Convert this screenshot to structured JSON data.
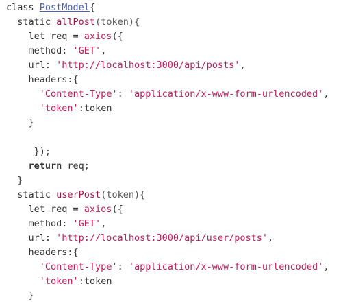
{
  "lines": [
    [
      {
        "t": "class ",
        "c": "kw"
      },
      {
        "t": "PostModel",
        "c": "cls"
      },
      {
        "t": "{",
        "c": "plain"
      }
    ],
    [
      {
        "t": "  static ",
        "c": "kw"
      },
      {
        "t": "allPost",
        "c": "fn-title"
      },
      {
        "t": "(token){",
        "c": "param"
      }
    ],
    [
      {
        "t": "    let req = ",
        "c": "plain"
      },
      {
        "t": "axios",
        "c": "fn"
      },
      {
        "t": "({",
        "c": "plain"
      }
    ],
    [
      {
        "t": "    method: ",
        "c": "plain"
      },
      {
        "t": "'GET'",
        "c": "str"
      },
      {
        "t": ",",
        "c": "plain"
      }
    ],
    [
      {
        "t": "    url: ",
        "c": "plain"
      },
      {
        "t": "'http://localhost:3000/api/posts'",
        "c": "str"
      },
      {
        "t": ",",
        "c": "plain"
      }
    ],
    [
      {
        "t": "    headers:{",
        "c": "plain"
      }
    ],
    [
      {
        "t": "      ",
        "c": "plain"
      },
      {
        "t": "'Content-Type'",
        "c": "str"
      },
      {
        "t": ": ",
        "c": "plain"
      },
      {
        "t": "'application/x-www-form-urlencoded'",
        "c": "str"
      },
      {
        "t": ",",
        "c": "plain"
      }
    ],
    [
      {
        "t": "      ",
        "c": "plain"
      },
      {
        "t": "'token'",
        "c": "str"
      },
      {
        "t": ":token",
        "c": "plain"
      }
    ],
    [
      {
        "t": "    }",
        "c": "plain"
      }
    ],
    [
      {
        "t": "",
        "c": "plain"
      }
    ],
    [
      {
        "t": "     });",
        "c": "plain"
      }
    ],
    [
      {
        "t": "    ",
        "c": "plain"
      },
      {
        "t": "return",
        "c": "bold"
      },
      {
        "t": " req;",
        "c": "plain"
      }
    ],
    [
      {
        "t": "  }",
        "c": "plain"
      }
    ],
    [
      {
        "t": "  static ",
        "c": "kw"
      },
      {
        "t": "userPost",
        "c": "fn-title"
      },
      {
        "t": "(token){",
        "c": "param"
      }
    ],
    [
      {
        "t": "    let req = ",
        "c": "plain"
      },
      {
        "t": "axios",
        "c": "fn"
      },
      {
        "t": "({",
        "c": "plain"
      }
    ],
    [
      {
        "t": "    method: ",
        "c": "plain"
      },
      {
        "t": "'GET'",
        "c": "str"
      },
      {
        "t": ",",
        "c": "plain"
      }
    ],
    [
      {
        "t": "    url: ",
        "c": "plain"
      },
      {
        "t": "'http://localhost:3000/api/user/posts'",
        "c": "str"
      },
      {
        "t": ",",
        "c": "plain"
      }
    ],
    [
      {
        "t": "    headers:{",
        "c": "plain"
      }
    ],
    [
      {
        "t": "      ",
        "c": "plain"
      },
      {
        "t": "'Content-Type'",
        "c": "str"
      },
      {
        "t": ": ",
        "c": "plain"
      },
      {
        "t": "'application/x-www-form-urlencoded'",
        "c": "str"
      },
      {
        "t": ",",
        "c": "plain"
      }
    ],
    [
      {
        "t": "      ",
        "c": "plain"
      },
      {
        "t": "'token'",
        "c": "str"
      },
      {
        "t": ":token",
        "c": "plain"
      }
    ],
    [
      {
        "t": "    }",
        "c": "plain"
      }
    ]
  ]
}
